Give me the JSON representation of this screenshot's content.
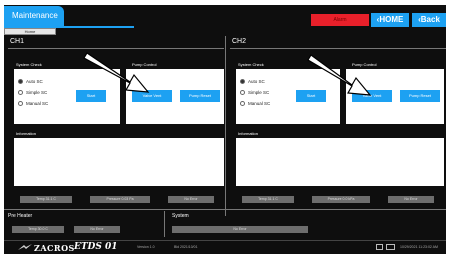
{
  "header": {
    "title": "Maintenance",
    "subtab": "Home",
    "alarm": "Alarm",
    "home_label": "HOME",
    "back_label": "Back"
  },
  "channels": [
    {
      "title": "CH1",
      "system_check_label": "System Check",
      "pump_control_label": "Pump Control",
      "information_label": "Information",
      "options": [
        "Auto SC",
        "Simple SC",
        "Manual SC"
      ],
      "selected": 0,
      "start_label": "Start",
      "valve_label": "Valve Vent",
      "pump_reset_label": "Pump Reset",
      "status": [
        "Temp 31.1 C",
        "Pressure 0.03 Pa",
        "No Error"
      ]
    },
    {
      "title": "CH2",
      "system_check_label": "System Check",
      "pump_control_label": "Pump Control",
      "information_label": "Information",
      "options": [
        "Auto SC",
        "Simple SC",
        "Manual SC"
      ],
      "selected": 0,
      "start_label": "Start",
      "valve_label": "Valve Vent",
      "pump_reset_label": "Pump Reset",
      "status": [
        "Temp 31.1 C",
        "Pressure 0.0 kPa",
        "No Error"
      ]
    }
  ],
  "preheater": {
    "label": "Pre Heater",
    "values": [
      "Temp 30.0 C",
      "No Error"
    ]
  },
  "system": {
    "label": "System",
    "status": "No Error"
  },
  "footer": {
    "brand": "ZACROS",
    "product": "ETDS 01",
    "version": "Version 1.0",
    "build": "Bld 2021/10/01",
    "datetime": "10/29/2021 11:23:02 AM"
  },
  "colors": {
    "accent": "#1da1f2",
    "alarm": "#e8202a",
    "background": "#0e0e0e"
  }
}
